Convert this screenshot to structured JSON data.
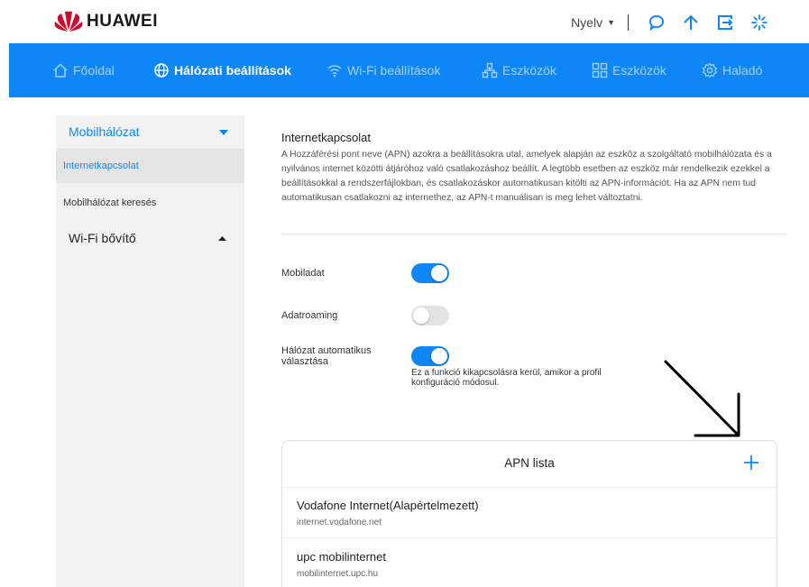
{
  "brand": {
    "name": "HUAWEI",
    "color": "#cf0a2c"
  },
  "topbar": {
    "language_label": "Nyelv",
    "icons": [
      "chat-icon",
      "upload-arrow-icon",
      "logout-icon",
      "loading-icon"
    ]
  },
  "nav": {
    "accent": "#0f86f5",
    "items": [
      {
        "label": "Főoldal",
        "icon": "home-icon",
        "active": false
      },
      {
        "label": "Hálózati beállítások",
        "icon": "globe-icon",
        "active": true
      },
      {
        "label": "Wi-Fi beállítások",
        "icon": "wifi-icon",
        "active": false
      },
      {
        "label": "Eszközök",
        "icon": "devices-icon",
        "active": false
      },
      {
        "label": "Eszközök",
        "icon": "apps-icon",
        "active": false
      },
      {
        "label": "Haladó",
        "icon": "gear-icon",
        "active": false
      }
    ]
  },
  "sidebar": {
    "groups": [
      {
        "label": "Mobilhálózat",
        "expanded": true,
        "items": [
          "Internetkapcsolat",
          "Mobilhálózat keresés"
        ]
      },
      {
        "label": "Wi-Fi bővítő",
        "expanded": false,
        "items": []
      }
    ]
  },
  "main": {
    "title": "Internetkapcsolat",
    "description": "A Hozzáférési pont neve (APN) azokra a beállításokra utal, amelyek alapján az eszköz a szolgáltató mobilhálózata és a nyilvános internet közötti átjáróhoz való csatlakozáshoz beállít. A legtöbb esetben az eszköz már rendelkezik ezekkel a beállításokkal a rendszerfájlokban, és csatlakozáskor automatikusan kitölti az APN-információt. Ha az APN nem tud automatikusan csatlakozni az internethez, az APN-t manuálisan is meg lehet változtatni.",
    "settings": [
      {
        "label": "Mobiladat",
        "enabled": true
      },
      {
        "label": "Adatroaming",
        "enabled": false
      },
      {
        "label": "Hálózat automatikus választása",
        "enabled": true,
        "hint": "Ez a funkció kikapcsolásra kerül, amikor a profil konfiguráció módosul."
      }
    ]
  },
  "apn": {
    "title": "APN lista",
    "add_icon": "plus-icon",
    "items": [
      {
        "name": "Vodafone Internet(Alapértelmezett)",
        "apn": "internet.vodafone.net"
      },
      {
        "name": "upc mobilinternet",
        "apn": "mobilinternet.upc.hu"
      }
    ]
  }
}
